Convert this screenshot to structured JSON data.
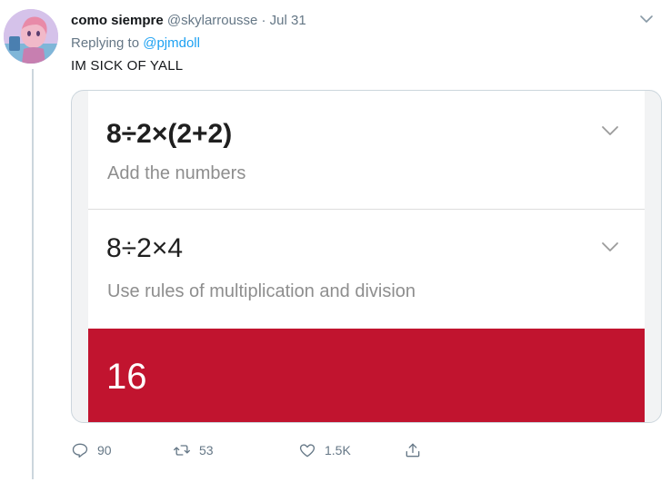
{
  "tweet": {
    "display_name": "como siempre",
    "handle": "@skylarrousse",
    "separator": "·",
    "date": "Jul 31",
    "replying_prefix": "Replying to ",
    "replying_to": "@pjmdoll",
    "text": "IM SICK OF YALL"
  },
  "media": {
    "steps": [
      {
        "expression": "8÷2×(2+2)",
        "description": "Add the numbers"
      },
      {
        "expression": "8÷2×4",
        "description": "Use rules of multiplication and division"
      }
    ],
    "answer": "16",
    "answer_color": "#c1142f"
  },
  "actions": {
    "reply_count": "90",
    "retweet_count": "53",
    "like_count": "1.5K"
  },
  "icons": {
    "caret": "chevron-down-icon",
    "reply": "reply-icon",
    "retweet": "retweet-icon",
    "like": "heart-icon",
    "share": "share-icon"
  },
  "colors": {
    "link": "#1da1f2",
    "secondary_text": "#657786"
  }
}
